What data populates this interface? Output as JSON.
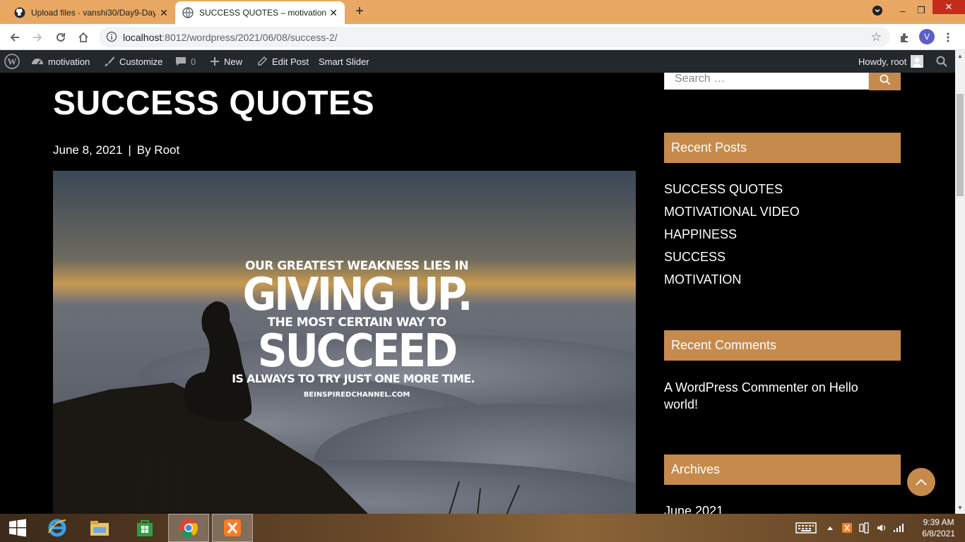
{
  "browser": {
    "tabs": [
      {
        "title": "Upload files · vanshi30/Day9-Day",
        "icon": "github-icon"
      },
      {
        "title": "SUCCESS QUOTES – motivation",
        "icon": "globe-icon"
      }
    ],
    "url_host": "localhost",
    "url_path": ":8012/wordpress/2021/06/08/success-2/",
    "profile_initial": "V"
  },
  "adminbar": {
    "site_name": "motivation",
    "customize": "Customize",
    "comments_count": "0",
    "new": "New",
    "edit_post": "Edit Post",
    "smart_slider": "Smart Slider",
    "howdy": "Howdy, root"
  },
  "post": {
    "title": "SUCCESS QUOTES",
    "date": "June 8, 2021",
    "separator": "|",
    "author": "By Root",
    "image_quote": {
      "line1": "OUR GREATEST WEAKNESS LIES IN",
      "line2": "GIVING UP.",
      "line3": "THE MOST CERTAIN WAY TO",
      "line4": "SUCCEED",
      "line5": "IS ALWAYS TO TRY JUST ONE MORE TIME.",
      "line6": "BEINSPIREDCHANNEL.COM"
    }
  },
  "sidebar": {
    "search_placeholder": "Search …",
    "recent_posts_title": "Recent Posts",
    "recent_posts": [
      "SUCCESS QUOTES",
      "MOTIVATIONAL VIDEO",
      "HAPPINESS",
      "SUCCESS",
      "MOTIVATION"
    ],
    "recent_comments_title": "Recent Comments",
    "recent_comment": "A WordPress Commenter on Hello world!",
    "archives_title": "Archives",
    "archive_item": "June 2021"
  },
  "taskbar": {
    "time": "9:39 AM",
    "date": "6/8/2021"
  },
  "colors": {
    "accent": "#c68a4c",
    "tabstrip": "#e8a863",
    "adminbar": "#23282d"
  }
}
